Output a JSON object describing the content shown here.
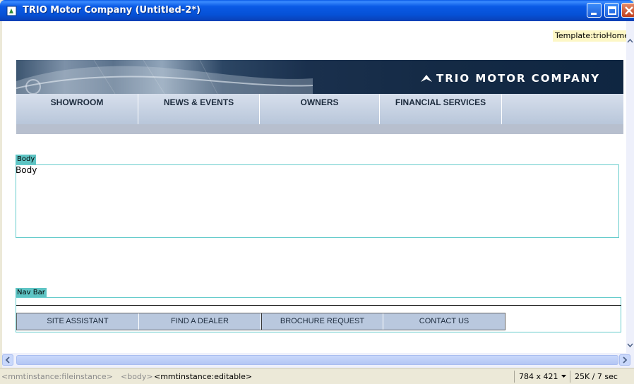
{
  "window": {
    "title": "TRIO Motor Company (Untitled-2*)"
  },
  "template_label": "Template:trioHome",
  "banner": {
    "brand": "TRIO MOTOR COMPANY"
  },
  "top_nav": [
    {
      "label": "SHOWROOM"
    },
    {
      "label": "NEWS & EVENTS"
    },
    {
      "label": "OWNERS"
    },
    {
      "label": "FINANCIAL SERVICES"
    },
    {
      "label": ""
    }
  ],
  "regions": {
    "body": {
      "tab_label": "Body",
      "content": "Body"
    },
    "nav_bar": {
      "tab_label": "Nav Bar"
    }
  },
  "bottom_nav": [
    {
      "label": "SITE ASSISTANT"
    },
    {
      "label": "FIND A DEALER"
    },
    {
      "label": "BROCHURE REQUEST"
    },
    {
      "label": "CONTACT US"
    }
  ],
  "status_bar": {
    "tags": [
      "<mmtinstance:fileinstance>",
      "<body>",
      "<mmtinstance:editable>"
    ],
    "window_size": "784 x 421",
    "download": "25K / 7 sec"
  },
  "colors": {
    "title_bar": "#0a5ae6",
    "editable_region": "#5ec4c4",
    "nav_background": "#b9c8de",
    "template_tag": "#fdf7c6"
  },
  "icons": [
    "document-app-icon",
    "minimize-icon",
    "maximize-icon",
    "close-icon",
    "scroll-left-arrow-icon",
    "scroll-right-arrow-icon",
    "scroll-up-arrow-icon",
    "scroll-down-arrow-icon",
    "brand-logo-icon",
    "dropdown-arrow-icon"
  ]
}
